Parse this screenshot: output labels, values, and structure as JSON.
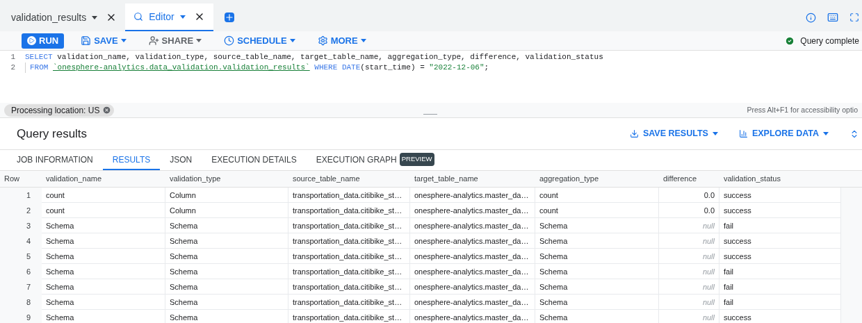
{
  "tabs": [
    {
      "label": "validation_results",
      "selected": false,
      "kind": "table"
    },
    {
      "label": "Editor",
      "selected": true,
      "kind": "query"
    }
  ],
  "toolbar": {
    "buttons": [
      {
        "label": "RUN",
        "kind": "run"
      },
      {
        "label": "SAVE",
        "kind": "save"
      },
      {
        "label": "SHARE",
        "kind": "share"
      },
      {
        "label": "SCHEDULE",
        "kind": "schedule"
      },
      {
        "label": "MORE",
        "kind": "more"
      }
    ],
    "status": "Query complete"
  },
  "editor": {
    "lines": [
      {
        "number": "1",
        "tokens": [
          {
            "text": "SELECT",
            "kind": "keyword"
          },
          {
            "text": " validation_name, validation_type, source_table_name, target_table_name, aggregation_type, difference, validation_status",
            "kind": "plain"
          }
        ]
      },
      {
        "number": "2",
        "tokens": [
          {
            "text": "FROM ",
            "kind": "keyword"
          },
          {
            "text": "`onesphere-analytics.data_validation.validation_results`",
            "kind": "table"
          },
          {
            "text": " WHERE DATE",
            "kind": "keyword"
          },
          {
            "text": "(start_time) = ",
            "kind": "plain"
          },
          {
            "text": "\"2022-12-06\"",
            "kind": "string"
          },
          {
            "text": ";",
            "kind": "plain"
          }
        ]
      }
    ]
  },
  "processing_location": "Processing location: US",
  "accessibility_hint": "Press Alt+F1 for accessibility optio",
  "results": {
    "title": "Query results",
    "actions": [
      {
        "label": "SAVE RESULTS",
        "kind": "save"
      },
      {
        "label": "EXPLORE DATA",
        "kind": "explore"
      }
    ],
    "tabs": [
      {
        "label": "JOB INFORMATION",
        "selected": false
      },
      {
        "label": "RESULTS",
        "selected": true
      },
      {
        "label": "JSON",
        "selected": false
      },
      {
        "label": "EXECUTION DETAILS",
        "selected": false
      },
      {
        "label": "EXECUTION GRAPH",
        "selected": false,
        "badge": "PREVIEW"
      }
    ],
    "columns": [
      "Row",
      "validation_name",
      "validation_type",
      "source_table_name",
      "target_table_name",
      "aggregation_type",
      "difference",
      "validation_status"
    ],
    "rows": [
      {
        "row": "1",
        "validation_name": "count",
        "validation_type": "Column",
        "source_table_name": "transportation_data.citibike_st…",
        "target_table_name": "onesphere-analytics.master_da…",
        "aggregation_type": "count",
        "difference": {
          "text": "0.0",
          "kind": "number"
        },
        "validation_status": "success"
      },
      {
        "row": "2",
        "validation_name": "count",
        "validation_type": "Column",
        "source_table_name": "transportation_data.citibike_st…",
        "target_table_name": "onesphere-analytics.master_da…",
        "aggregation_type": "count",
        "difference": {
          "text": "0.0",
          "kind": "number"
        },
        "validation_status": "success"
      },
      {
        "row": "3",
        "validation_name": "Schema",
        "validation_type": "Schema",
        "source_table_name": "transportation_data.citibike_st…",
        "target_table_name": "onesphere-analytics.master_da…",
        "aggregation_type": "Schema",
        "difference": {
          "text": "null",
          "kind": "null"
        },
        "validation_status": "fail"
      },
      {
        "row": "4",
        "validation_name": "Schema",
        "validation_type": "Schema",
        "source_table_name": "transportation_data.citibike_st…",
        "target_table_name": "onesphere-analytics.master_da…",
        "aggregation_type": "Schema",
        "difference": {
          "text": "null",
          "kind": "null"
        },
        "validation_status": "success"
      },
      {
        "row": "5",
        "validation_name": "Schema",
        "validation_type": "Schema",
        "source_table_name": "transportation_data.citibike_st…",
        "target_table_name": "onesphere-analytics.master_da…",
        "aggregation_type": "Schema",
        "difference": {
          "text": "null",
          "kind": "null"
        },
        "validation_status": "success"
      },
      {
        "row": "6",
        "validation_name": "Schema",
        "validation_type": "Schema",
        "source_table_name": "transportation_data.citibike_st…",
        "target_table_name": "onesphere-analytics.master_da…",
        "aggregation_type": "Schema",
        "difference": {
          "text": "null",
          "kind": "null"
        },
        "validation_status": "fail"
      },
      {
        "row": "7",
        "validation_name": "Schema",
        "validation_type": "Schema",
        "source_table_name": "transportation_data.citibike_st…",
        "target_table_name": "onesphere-analytics.master_da…",
        "aggregation_type": "Schema",
        "difference": {
          "text": "null",
          "kind": "null"
        },
        "validation_status": "fail"
      },
      {
        "row": "8",
        "validation_name": "Schema",
        "validation_type": "Schema",
        "source_table_name": "transportation_data.citibike_st…",
        "target_table_name": "onesphere-analytics.master_da…",
        "aggregation_type": "Schema",
        "difference": {
          "text": "null",
          "kind": "null"
        },
        "validation_status": "fail"
      },
      {
        "row": "9",
        "validation_name": "Schema",
        "validation_type": "Schema",
        "source_table_name": "transportation_data.citibike_st…",
        "target_table_name": "onesphere-analytics.master_da…",
        "aggregation_type": "Schema",
        "difference": {
          "text": "null",
          "kind": "null"
        },
        "validation_status": "success"
      }
    ]
  }
}
